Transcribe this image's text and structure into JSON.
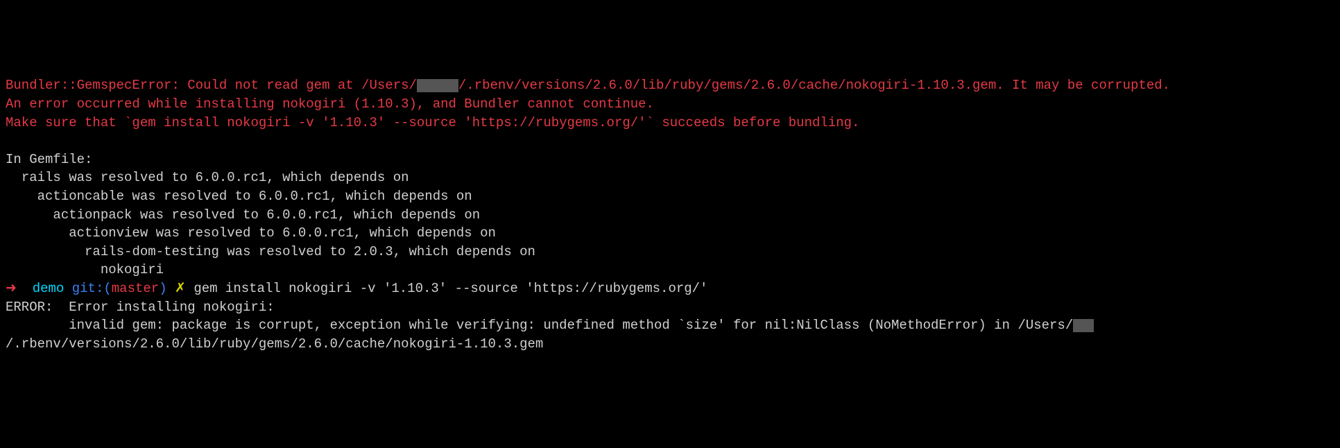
{
  "error": {
    "line1_pre": "Bundler::GemspecError: Could not read gem at /Users/",
    "line1_post": "/.rbenv/versions/2.6.0/lib/ruby/gems/2.6.0/cache/nokogiri-1.10.3.gem. It may be corrupted.",
    "line2": "An error occurred while installing nokogiri (1.10.3), and Bundler cannot continue.",
    "line3": "Make sure that `gem install nokogiri -v '1.10.3' --source 'https://rubygems.org/'` succeeds before bundling."
  },
  "gemfile": {
    "header": "In Gemfile:",
    "l1": "  rails was resolved to 6.0.0.rc1, which depends on",
    "l2": "    actioncable was resolved to 6.0.0.rc1, which depends on",
    "l3": "      actionpack was resolved to 6.0.0.rc1, which depends on",
    "l4": "        actionview was resolved to 6.0.0.rc1, which depends on",
    "l5": "          rails-dom-testing was resolved to 2.0.3, which depends on",
    "l6": "            nokogiri"
  },
  "prompt": {
    "arrow": "➜",
    "dir": "demo",
    "git_label": "git:(",
    "branch": "master",
    "git_close": ")",
    "dirty": "✗",
    "command": "gem install nokogiri -v '1.10.3' --source 'https://rubygems.org/'"
  },
  "install_error": {
    "l1": "ERROR:  Error installing nokogiri:",
    "l2_pre": "        invalid gem: package is corrupt, exception while verifying: undefined method `size' for nil:NilClass (NoMethodError) in /Users/",
    "l2_post": "/.rbenv/versions/2.6.0/lib/ruby/gems/2.6.0/cache/nokogiri-1.10.3.gem"
  }
}
